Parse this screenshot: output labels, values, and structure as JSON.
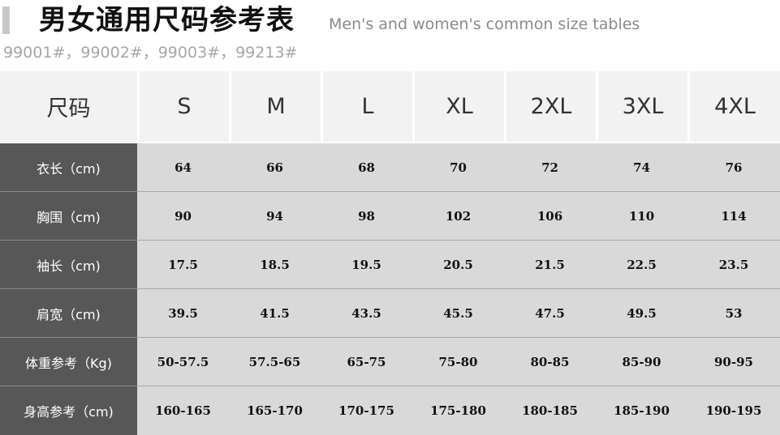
{
  "header": {
    "title_cn": "男女通用尺码参考表",
    "title_en": "Men's and women's common size tables",
    "model_codes": "99001#，99002#，99003#，99213#"
  },
  "table": {
    "corner_label": "尺码",
    "sizes": [
      "S",
      "M",
      "L",
      "XL",
      "2XL",
      "3XL",
      "4XL"
    ],
    "rows": [
      {
        "label": "衣长（cm)",
        "values": [
          "64",
          "66",
          "68",
          "70",
          "72",
          "74",
          "76"
        ]
      },
      {
        "label": "胸围（cm)",
        "values": [
          "90",
          "94",
          "98",
          "102",
          "106",
          "110",
          "114"
        ]
      },
      {
        "label": "袖长（cm)",
        "values": [
          "17.5",
          "18.5",
          "19.5",
          "20.5",
          "21.5",
          "22.5",
          "23.5"
        ]
      },
      {
        "label": "肩宽（cm)",
        "values": [
          "39.5",
          "41.5",
          "43.5",
          "45.5",
          "47.5",
          "49.5",
          "53"
        ]
      },
      {
        "label": "体重参考（Kg)",
        "values": [
          "50-57.5",
          "57.5-65",
          "65-75",
          "75-80",
          "80-85",
          "85-90",
          "90-95"
        ]
      },
      {
        "label": "身高参考（cm)",
        "values": [
          "160-165",
          "165-170",
          "170-175",
          "175-180",
          "180-185",
          "185-190",
          "190-195"
        ]
      }
    ]
  },
  "colors": {
    "label_column_bg": "#575757",
    "value_area_bg": "#d9d9d9",
    "header_cell_bg": "#f2f2f2",
    "title_accent_bar": "#c8c8c8"
  }
}
